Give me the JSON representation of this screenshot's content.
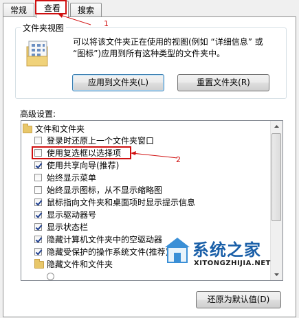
{
  "tabs": [
    {
      "label": "常规"
    },
    {
      "label": "查看"
    },
    {
      "label": "搜索"
    }
  ],
  "folder_views": {
    "title": "文件夹视图",
    "description": "可以将该文件夹正在使用的视图(例如 “详细信息” 或 “图标”)应用到所有这种类型的文件夹中。",
    "apply_button": "应用到文件夹(L)",
    "reset_button": "重置文件夹(R)"
  },
  "advanced": {
    "title": "高级设置:",
    "items": [
      {
        "type": "folder",
        "label": "文件和文件夹",
        "indent": 0
      },
      {
        "type": "checkbox",
        "label": "登录时还原上一个文件夹窗口",
        "checked": false
      },
      {
        "type": "checkbox",
        "label": "使用复选框以选择项",
        "checked": false
      },
      {
        "type": "checkbox",
        "label": "使用共享向导(推荐)",
        "checked": true
      },
      {
        "type": "checkbox",
        "label": "始终显示菜单",
        "checked": false
      },
      {
        "type": "checkbox",
        "label": "始终显示图标，从不显示缩略图",
        "checked": false
      },
      {
        "type": "checkbox",
        "label": "鼠标指向文件夹和桌面项时显示提示信息",
        "checked": true
      },
      {
        "type": "checkbox",
        "label": "显示驱动器号",
        "checked": true
      },
      {
        "type": "checkbox",
        "label": "显示状态栏",
        "checked": true
      },
      {
        "type": "checkbox",
        "label": "隐藏计算机文件夹中的空驱动器",
        "checked": true
      },
      {
        "type": "checkbox",
        "label": "隐藏受保护的操作系统文件(推荐)",
        "checked": true
      },
      {
        "type": "folder",
        "label": "隐藏文件和文件夹",
        "indent": 1
      }
    ]
  },
  "restore_button": "还原为默认值(D)",
  "annotations": {
    "one": "1",
    "two": "2"
  },
  "watermark": {
    "brand": "系统之家",
    "url": "XITONGZHIJIA.NET"
  },
  "colors": {
    "annotation": "#d01010",
    "accent": "#3c7fb1"
  }
}
